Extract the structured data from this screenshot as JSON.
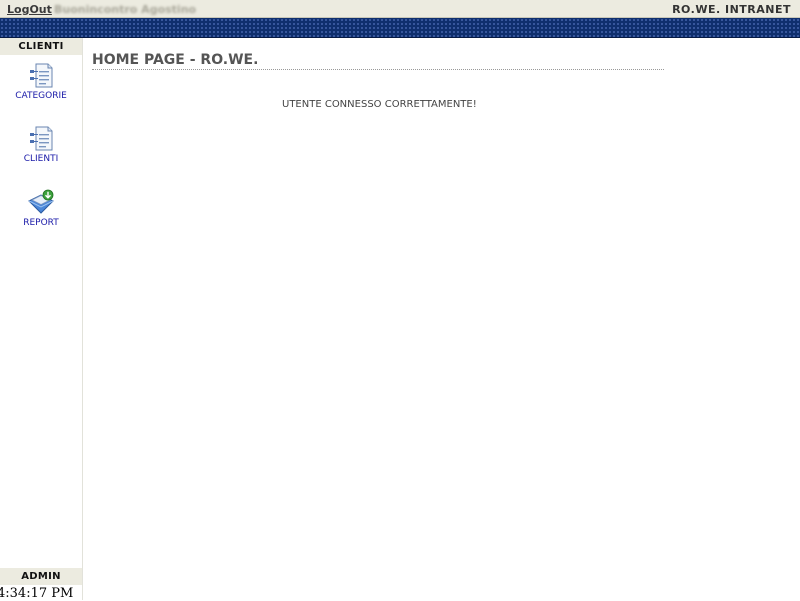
{
  "topbar": {
    "logout_label": "LogOut",
    "username": "Buonincontro Agostino",
    "brand": "RO.WE. INTRANET"
  },
  "sidebar": {
    "section_title": "CLIENTI",
    "items": [
      {
        "label": "CATEGORIE",
        "icon": "document-list-icon"
      },
      {
        "label": "CLIENTI",
        "icon": "document-list-icon"
      },
      {
        "label": "REPORT",
        "icon": "report-download-icon"
      }
    ],
    "footer_title": "ADMIN"
  },
  "clock": "4:34:17 PM",
  "main": {
    "title": "HOME PAGE - RO.WE.",
    "message": "UTENTE CONNESSO CORRETTAMENTE!"
  },
  "colors": {
    "header_bg": "#ecebe0",
    "band_bg": "#0f2f6e",
    "link": "#1a1aa8"
  }
}
